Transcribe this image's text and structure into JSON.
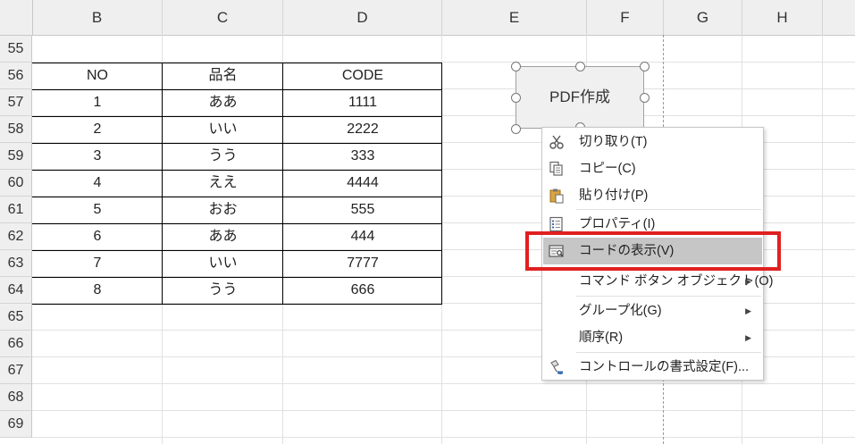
{
  "columns": [
    "B",
    "C",
    "D",
    "E",
    "F",
    "G",
    "H"
  ],
  "rows": [
    "55",
    "56",
    "57",
    "58",
    "59",
    "60",
    "61",
    "62",
    "63",
    "64",
    "65",
    "66",
    "67",
    "68",
    "69"
  ],
  "table": {
    "headers": [
      "NO",
      "品名",
      "CODE"
    ],
    "rows": [
      [
        "1",
        "ああ",
        "1111"
      ],
      [
        "2",
        "いい",
        "2222"
      ],
      [
        "3",
        "うう",
        "333"
      ],
      [
        "4",
        "ええ",
        "4444"
      ],
      [
        "5",
        "おお",
        "555"
      ],
      [
        "6",
        "ああ",
        "444"
      ],
      [
        "7",
        "いい",
        "7777"
      ],
      [
        "8",
        "うう",
        "666"
      ]
    ]
  },
  "shape_button": {
    "label": "PDF作成"
  },
  "context_menu": {
    "items": [
      {
        "label": "切り取り(T)",
        "icon": "scissors-icon"
      },
      {
        "label": "コピー(C)",
        "icon": "copy-icon"
      },
      {
        "label": "貼り付け(P)",
        "icon": "paste-icon"
      },
      {
        "label": "プロパティ(I)",
        "icon": "properties-icon"
      },
      {
        "label": "コードの表示(V)",
        "icon": "view-code-icon",
        "highlighted": true
      },
      {
        "label": "コマンド ボタン オブジェクト(O)",
        "submenu": true
      },
      {
        "label": "グループ化(G)",
        "submenu": true
      },
      {
        "label": "順序(R)",
        "submenu": true
      },
      {
        "label": "コントロールの書式設定(F)...",
        "icon": "format-control-icon"
      }
    ]
  },
  "colors": {
    "highlight_box": "#e02020",
    "menu_highlight": "#c6c6c6"
  }
}
